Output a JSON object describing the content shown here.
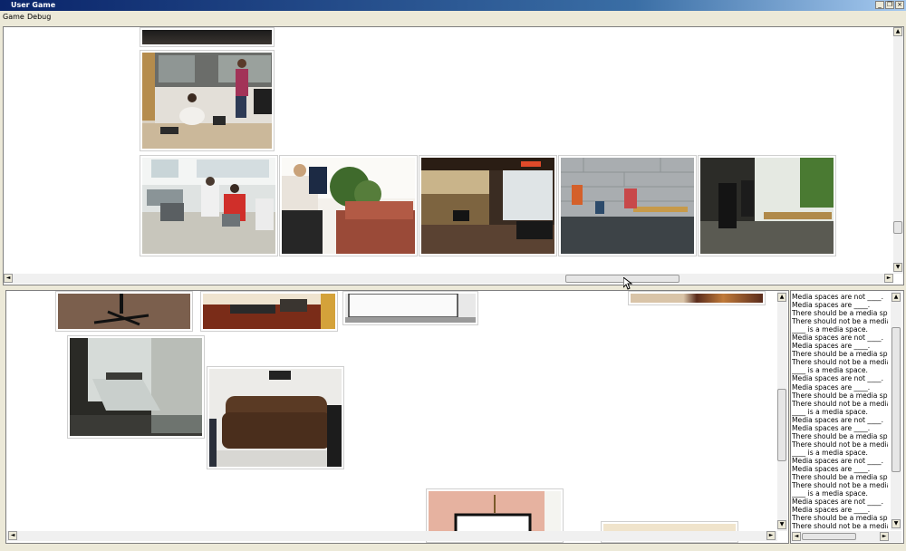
{
  "window": {
    "title": "User Game",
    "minimize": "_",
    "restore": "❐",
    "close": "×"
  },
  "menu": {
    "items": [
      "Game",
      "Debug"
    ]
  },
  "chat_log": {
    "lines": [
      "Media spaces are not ____.",
      "Media spaces are ____.",
      "There should be a media space",
      "There should not be a media spa",
      "____ is a media space.",
      "Media spaces are not ____.",
      "Media spaces are ____.",
      "There should be a media space",
      "There should not be a media spa",
      "____ is a media space.",
      "Media spaces are not ____.",
      "Media spaces are ____.",
      "There should be a media space",
      "There should not be a media spa",
      "____ is a media space.",
      "Media spaces are not ____.",
      "Media spaces are ____.",
      "There should be a media space",
      "There should not be a media spa",
      "____ is a media space.",
      "Media spaces are not ____.",
      "Media spaces are ____.",
      "There should be a media space",
      "There should not be a media spa",
      "____ is a media space.",
      "Media spaces are not ____.",
      "Media spaces are ____.",
      "There should be a media space",
      "There should not be a media spa"
    ]
  },
  "icons": {
    "arrow_up": "▲",
    "arrow_down": "▼",
    "arrow_left": "◄",
    "arrow_right": "►"
  }
}
